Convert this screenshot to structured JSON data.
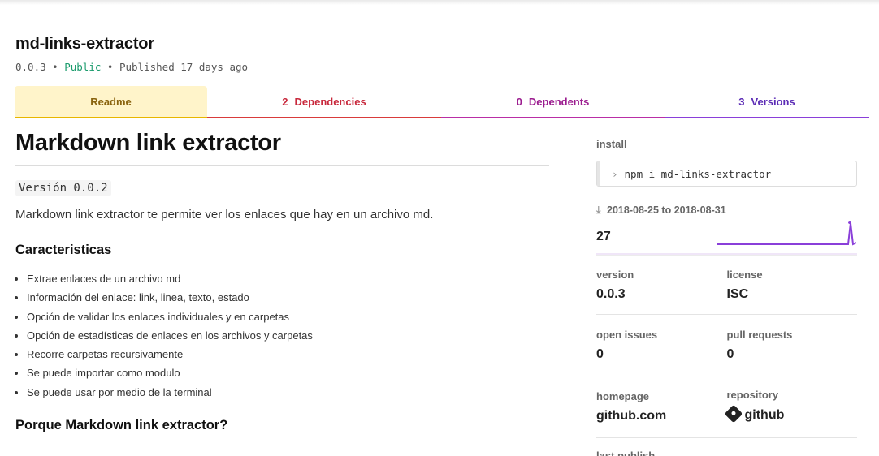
{
  "package": {
    "name": "md-links-extractor",
    "version": "0.0.3",
    "sep": "•",
    "visibility": "Public",
    "published": "Published 17 days ago"
  },
  "tabs": [
    {
      "label": "Readme",
      "count": ""
    },
    {
      "label": "Dependencies",
      "count": "2"
    },
    {
      "label": "Dependents",
      "count": "0"
    },
    {
      "label": "Versions",
      "count": "3"
    }
  ],
  "readme": {
    "title": "Markdown link extractor",
    "version_code": "Versión 0.0.2",
    "lead": "Markdown link extractor te permite ver los enlaces que hay en un archivo md.",
    "features_heading": "Caracteristicas",
    "features": [
      "Extrae enlaces de un archivo md",
      "Información del enlace: link, linea, texto, estado",
      "Opción de validar los enlaces individuales y en carpetas",
      "Opción de estadísticas de enlaces en los archivos y carpetas",
      "Recorre carpetas recursivamente",
      "Se puede importar como modulo",
      "Se puede usar por medio de la terminal"
    ],
    "why_heading": "Porque Markdown link extractor?"
  },
  "sidebar": {
    "install_label": "install",
    "install_prompt": "›",
    "install_cmd": "npm i md-links-extractor",
    "downloads_range": "2018-08-25 to 2018-08-31",
    "downloads_count": "27",
    "version_label": "version",
    "version_value": "0.0.3",
    "license_label": "license",
    "license_value": "ISC",
    "issues_label": "open issues",
    "issues_value": "0",
    "prs_label": "pull requests",
    "prs_value": "0",
    "homepage_label": "homepage",
    "homepage_value": "github.com",
    "repo_label": "repository",
    "repo_value": "github",
    "last_publish_label": "last publish"
  },
  "colors": {
    "public": "#1a9b6c",
    "readme_tab": "#fff4ca",
    "deps_tab": "#d93b3b",
    "dependents_tab": "#b92ea6",
    "versions_tab": "#8a3fd9",
    "sparkline": "#8a3fd9"
  },
  "icons": {
    "download": "download-arrow-icon",
    "repository": "git-icon"
  }
}
